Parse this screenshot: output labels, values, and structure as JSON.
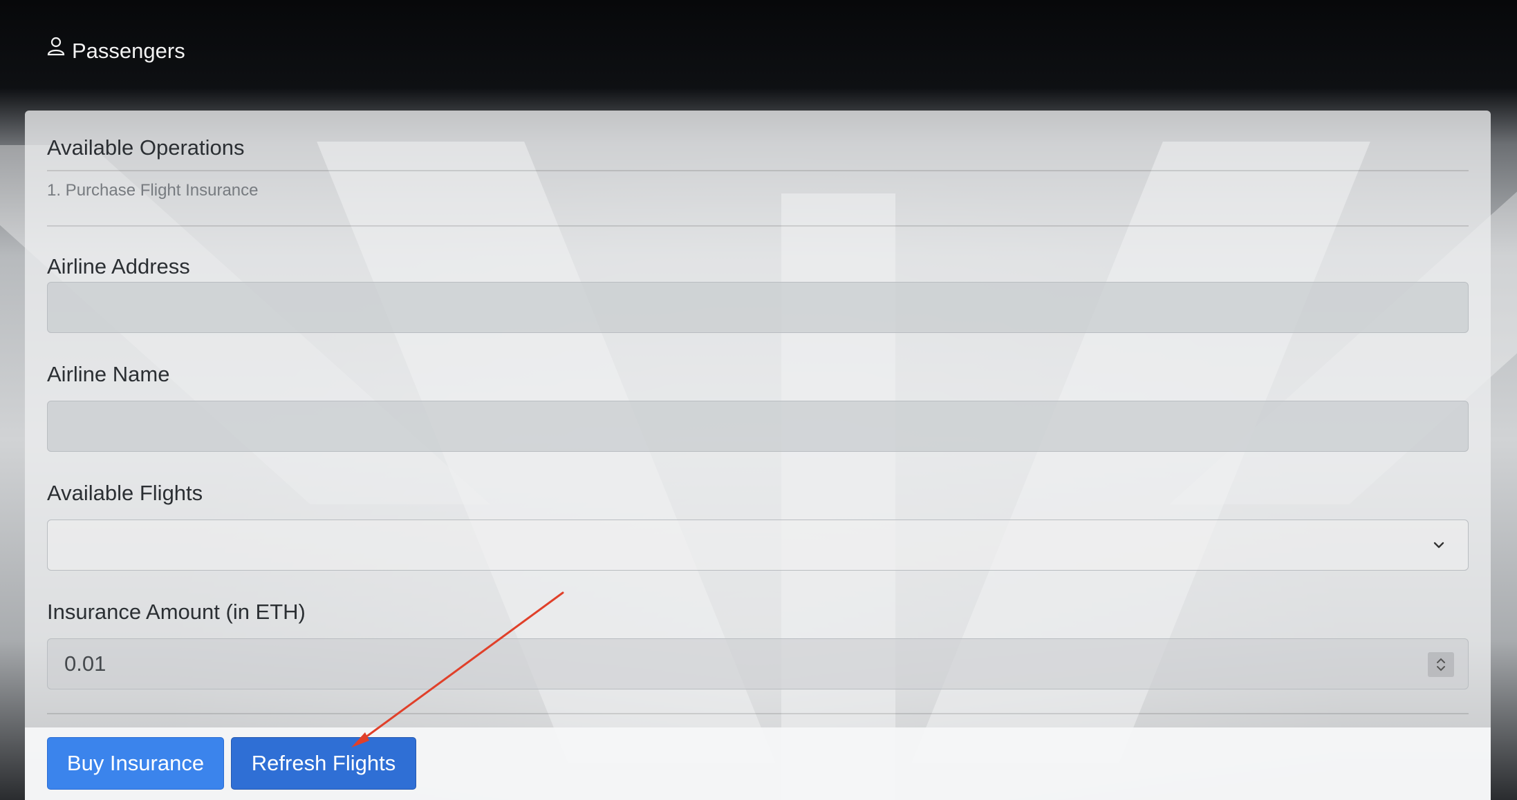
{
  "nav": {
    "passengers_label": "Passengers",
    "icon": "person-icon"
  },
  "panel": {
    "title": "Available Operations",
    "subtitle": "1. Purchase Flight Insurance"
  },
  "form": {
    "airline_address": {
      "label": "Airline Address",
      "value": ""
    },
    "airline_name": {
      "label": "Airline Name",
      "value": ""
    },
    "available_flights": {
      "label": "Available Flights",
      "selected": ""
    },
    "insurance_amount": {
      "label": "Insurance Amount (in ETH)",
      "value": "0.01"
    }
  },
  "actions": {
    "buy_label": "Buy Insurance",
    "refresh_label": "Refresh Flights"
  },
  "colors": {
    "primary": "#3b84ec",
    "primary_active": "#2f6fd5",
    "annotation_arrow": "#e0402a"
  }
}
